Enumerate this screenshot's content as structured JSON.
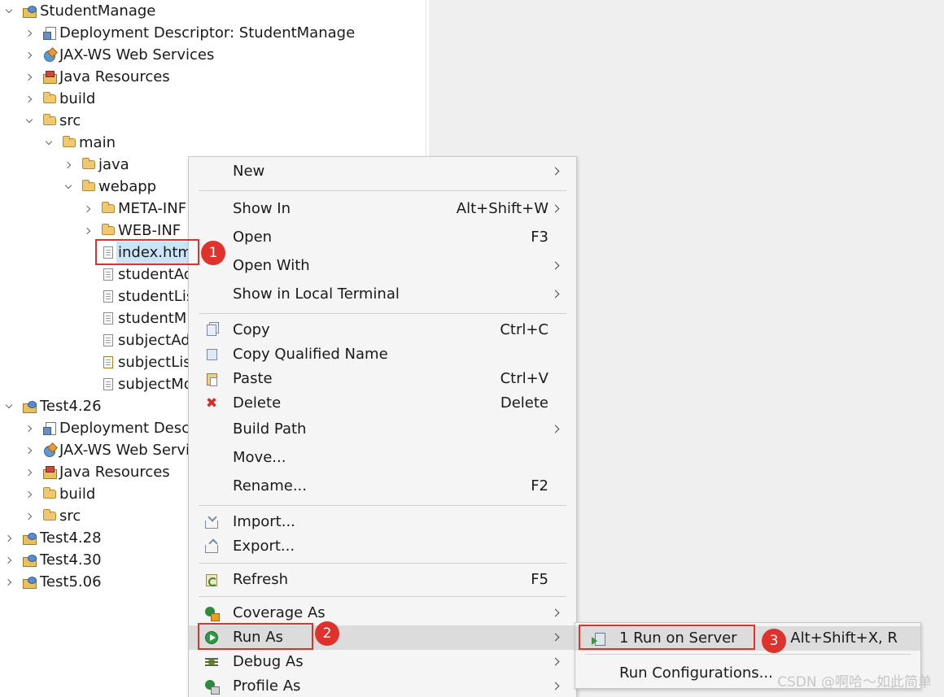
{
  "tree": {
    "rows": [
      {
        "label": "StudentManage",
        "icon": "project-icon",
        "expanded": true
      },
      {
        "label": "Deployment Descriptor: StudentManage",
        "icon": "deployment-descriptor-icon",
        "expanded": false
      },
      {
        "label": "JAX-WS Web Services",
        "icon": "web-services-icon",
        "expanded": false
      },
      {
        "label": "Java Resources",
        "icon": "java-resources-icon",
        "expanded": false
      },
      {
        "label": "build",
        "icon": "folder-icon",
        "expanded": false
      },
      {
        "label": "src",
        "icon": "folder-icon",
        "expanded": true
      },
      {
        "label": "main",
        "icon": "folder-icon",
        "expanded": true
      },
      {
        "label": "java",
        "icon": "folder-icon",
        "expanded": false
      },
      {
        "label": "webapp",
        "icon": "folder-icon",
        "expanded": true
      },
      {
        "label": "META-INF",
        "icon": "folder-icon",
        "expanded": false
      },
      {
        "label": "WEB-INF",
        "icon": "folder-icon",
        "expanded": false
      },
      {
        "label": "index.htm",
        "icon": "file-icon",
        "selected": true
      },
      {
        "label": "studentAd",
        "icon": "file-icon"
      },
      {
        "label": "studentLis",
        "icon": "file-icon"
      },
      {
        "label": "studentM",
        "icon": "file-icon"
      },
      {
        "label": "subjectAd",
        "icon": "file-icon"
      },
      {
        "label": "subjectLis",
        "icon": "jsp-file-icon"
      },
      {
        "label": "subjectMo",
        "icon": "file-icon"
      },
      {
        "label": "Test4.26",
        "icon": "project-icon",
        "expanded": true
      },
      {
        "label": "Deployment Descr",
        "icon": "deployment-descriptor-icon",
        "expanded": false
      },
      {
        "label": "JAX-WS Web Servi",
        "icon": "web-services-icon",
        "expanded": false
      },
      {
        "label": "Java Resources",
        "icon": "java-resources-icon",
        "expanded": false
      },
      {
        "label": "build",
        "icon": "folder-icon",
        "expanded": false
      },
      {
        "label": "src",
        "icon": "folder-icon",
        "expanded": false
      },
      {
        "label": "Test4.28",
        "icon": "project-icon",
        "expanded": false
      },
      {
        "label": "Test4.30",
        "icon": "project-icon",
        "expanded": false
      },
      {
        "label": "Test5.06",
        "icon": "project-icon",
        "expanded": false
      }
    ]
  },
  "context_menu": {
    "items": [
      {
        "label": "New",
        "shortcut": "",
        "submenu": true
      },
      {
        "label": "Show In",
        "shortcut": "Alt+Shift+W",
        "submenu": true
      },
      {
        "label": "Open",
        "shortcut": "F3",
        "submenu": false
      },
      {
        "label": "Open With",
        "shortcut": "",
        "submenu": true
      },
      {
        "label": "Show in Local Terminal",
        "shortcut": "",
        "submenu": true
      },
      {
        "label": "Copy",
        "shortcut": "Ctrl+C",
        "icon": "copy-icon"
      },
      {
        "label": "Copy Qualified Name",
        "shortcut": "",
        "icon": "copy-qualified-name-icon"
      },
      {
        "label": "Paste",
        "shortcut": "Ctrl+V",
        "icon": "paste-icon"
      },
      {
        "label": "Delete",
        "shortcut": "Delete",
        "icon": "delete-icon"
      },
      {
        "label": "Build Path",
        "shortcut": "",
        "submenu": true
      },
      {
        "label": "Move...",
        "shortcut": ""
      },
      {
        "label": "Rename...",
        "shortcut": "F2"
      },
      {
        "label": "Import...",
        "shortcut": "",
        "icon": "import-icon"
      },
      {
        "label": "Export...",
        "shortcut": "",
        "icon": "export-icon"
      },
      {
        "label": "Refresh",
        "shortcut": "F5",
        "icon": "refresh-icon"
      },
      {
        "label": "Coverage As",
        "shortcut": "",
        "submenu": true,
        "icon": "coverage-icon"
      },
      {
        "label": "Run As",
        "shortcut": "",
        "submenu": true,
        "icon": "run-icon",
        "highlighted": true
      },
      {
        "label": "Debug As",
        "shortcut": "",
        "submenu": true,
        "icon": "debug-icon"
      },
      {
        "label": "Profile As",
        "shortcut": "",
        "submenu": true,
        "icon": "profile-icon"
      }
    ]
  },
  "submenu": {
    "items": [
      {
        "label": "1 Run on Server",
        "shortcut": "Alt+Shift+X, R",
        "icon": "run-on-server-icon"
      },
      {
        "label": "Run Configurations...",
        "shortcut": ""
      }
    ]
  },
  "annotations": {
    "badge_1": "1",
    "badge_2": "2",
    "badge_3": "3",
    "color": "#e0322c"
  },
  "watermark": "CSDN @啊哈～如此简单"
}
